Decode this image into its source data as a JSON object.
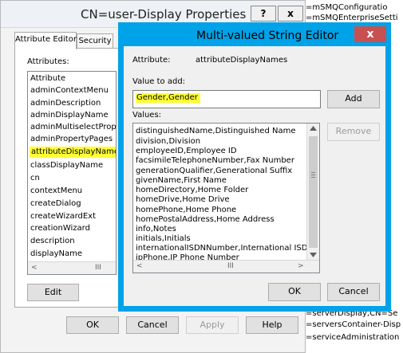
{
  "background_list": {
    "items": [
      "=mSMQConfiguratio",
      "=mSMQEnterpriseSetti",
      "=serverDisplay,CN=Se",
      "=serversContainer-Disp",
      "=serviceAdministration"
    ]
  },
  "properties_dialog": {
    "title": "CN=user-Display Properties",
    "help_button": "?",
    "close_button": "x",
    "tabs": [
      "Attribute Editor",
      "Security"
    ],
    "attributes_label": "Attributes:",
    "attributes": [
      "Attribute",
      "adminContextMenu",
      "adminDescription",
      "adminDisplayName",
      "adminMultiselectProp...",
      "adminPropertyPages",
      "attributeDisplayNames",
      "classDisplayName",
      "cn",
      "contextMenu",
      "createDialog",
      "createWizardExt",
      "creationWizard",
      "description",
      "displayName"
    ],
    "scroll_left": "<",
    "scroll_mid": "III",
    "edit_button": "Edit",
    "ok_button": "OK",
    "cancel_button": "Cancel",
    "apply_button": "Apply",
    "help_text_button": "Help"
  },
  "editor": {
    "title": "Multi-valued String Editor",
    "close_glyph": "x",
    "attribute_label": "Attribute:",
    "attribute_value": "attributeDisplayNames",
    "value_to_add_label": "Value to add:",
    "value_to_add": "Gender,Gender",
    "add_button": "Add",
    "values_label": "Values:",
    "remove_button": "Remove",
    "values": [
      "distinguishedName,Distinguished Name",
      "division,Division",
      "employeeID,Employee ID",
      "facsimileTelephoneNumber,Fax Number",
      "generationQualifier,Generational Suffix",
      "givenName,First Name",
      "homeDirectory,Home Folder",
      "homeDrive,Home Drive",
      "homePhone,Home Phone",
      "homePostalAddress,Home Address",
      "info,Notes",
      "initials,Initials",
      "internationalISDNNumber,International ISDN Nur",
      "ipPhone,IP Phone Number"
    ],
    "scroll_left": "<",
    "scroll_mid": "III",
    "scroll_right": ">",
    "ok_button": "OK",
    "cancel_button": "Cancel"
  },
  "colors": {
    "editor_frame": "#00a2e8",
    "close_button": "#c75050",
    "highlight": "#ffff33"
  }
}
